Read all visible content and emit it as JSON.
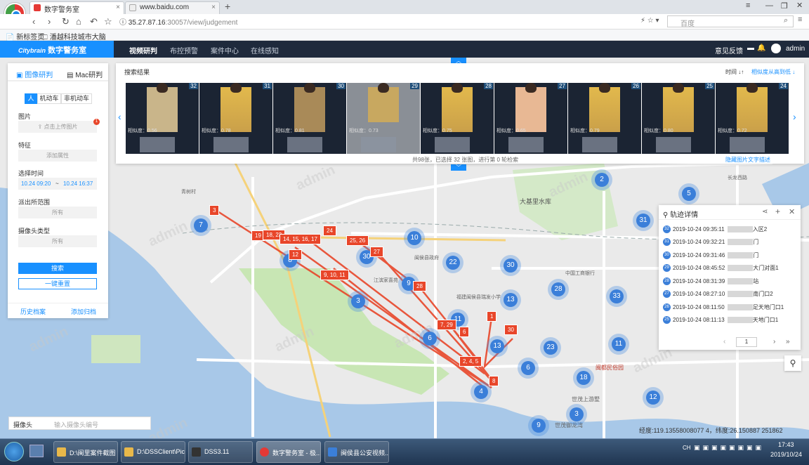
{
  "browser": {
    "tabs": [
      {
        "title": "数字警务室",
        "active": true
      },
      {
        "title": "www.baidu.com",
        "active": false
      }
    ],
    "new_tab": "+",
    "url_host": "35.27.87.16",
    "url_path": ":30057/view/judgement",
    "search_placeholder": "百度",
    "bookmarks": [
      "新标签页",
      "潘越科技城市大脑"
    ]
  },
  "app": {
    "brand_prefix": "Citybrain",
    "brand_name": "数字警务室",
    "nav": [
      "视频研判",
      "布控预警",
      "案件中心",
      "在线感知"
    ],
    "user_items": [
      "意见反馈",
      "admin"
    ]
  },
  "left_panel": {
    "tabs": [
      "图像研判",
      "Mac研判"
    ],
    "subtabs": [
      "人",
      "机动车",
      "非机动车"
    ],
    "image_label": "图片",
    "upload_text": "点击上传图片",
    "upload_badge": "1",
    "feature_label": "特征",
    "feature_placeholder": "添加属性",
    "time_label": "选择时间",
    "time_from": "10.24 09:20",
    "time_sep": "~",
    "time_to": "10.24 16:37",
    "station_label": "派出所范围",
    "station_value": "所有",
    "camera_type_label": "摄像头类型",
    "camera_type_value": "所有",
    "search_btn": "搜索",
    "reset_btn": "一键重置",
    "footer": [
      "历史档案",
      "添加归档"
    ]
  },
  "results": {
    "title": "搜索结果",
    "sort_time": "时间 ↓↑",
    "sort_sim": "相似度从高到低 ↓",
    "cards": [
      {
        "num": "32",
        "score": "相似度：0.56"
      },
      {
        "num": "31",
        "score": "相似度：0.78"
      },
      {
        "num": "30",
        "score": "相似度：0.81"
      },
      {
        "num": "29",
        "score": "相似度：0.73"
      },
      {
        "num": "28",
        "score": "相似度：0.75"
      },
      {
        "num": "27",
        "score": "相似度：0.65"
      },
      {
        "num": "26",
        "score": "相似度：0.79"
      },
      {
        "num": "25",
        "score": "相似度：0.80"
      },
      {
        "num": "24",
        "score": "相似度：0.72"
      }
    ],
    "summary": "共98张，已选择 32 张图，进行第 0 轮检索",
    "hide_link": "隐藏图片文字描述"
  },
  "track": {
    "title": "轨迹详情",
    "rows": [
      {
        "n": "32",
        "time": "2019-10-24 09:35:11",
        "tail": "入区2"
      },
      {
        "n": "31",
        "time": "2019-10-24 09:32:21",
        "tail": "门"
      },
      {
        "n": "30",
        "time": "2019-10-24 09:31:46",
        "tail": "门"
      },
      {
        "n": "29",
        "time": "2019-10-24 08:45:52",
        "tail": "大门对面1"
      },
      {
        "n": "28",
        "time": "2019-10-24 08:31:39",
        "tail": "站"
      },
      {
        "n": "27",
        "time": "2019-10-24 08:27:10",
        "tail": "南门口2"
      },
      {
        "n": "26",
        "time": "2019-10-24 08:11:50",
        "tail": "足天地门口1"
      },
      {
        "n": "25",
        "time": "2019-10-24 08:11:13",
        "tail": "天地门口1"
      }
    ],
    "page": "1"
  },
  "map": {
    "camera_label": "摄像头",
    "camera_placeholder": "输入摄像头编号",
    "coords": "经度:119.13558008077 4，纬度:26.150887 251862",
    "watermark": "admin",
    "clusters": [
      "7",
      "8",
      "3",
      "30",
      "10",
      "9",
      "22",
      "30",
      "11",
      "13",
      "6",
      "13",
      "23",
      "6",
      "4",
      "18",
      "12",
      "3",
      "9",
      "28",
      "33",
      "11",
      "2",
      "5",
      "31"
    ],
    "tags": [
      "3",
      "19",
      "18, 23",
      "14, 15, 16, 17",
      "24",
      "25, 26",
      "27",
      "12",
      "9, 10, 11",
      "28",
      "7, 29",
      "6",
      "1",
      "30",
      "2, 4, 5",
      "8"
    ],
    "places": [
      "大基里水库",
      "闽侯县政府",
      "世茂上游墅",
      "闽都民俗园",
      "江滨家喜苑",
      "世茂御龙湾",
      "青树村",
      "长龙西路",
      "中国工商银行",
      "福建闽侯县瑞发小学"
    ]
  },
  "taskbar": {
    "items": [
      "D:\\闽里案件截图",
      "D:\\DSSClient\\Pic...",
      "DSS3.11",
      "数字警务室 - 极...",
      "闽侯县公安视频..."
    ],
    "lang": "CH",
    "time": "17:43",
    "date": "2019/10/24"
  }
}
